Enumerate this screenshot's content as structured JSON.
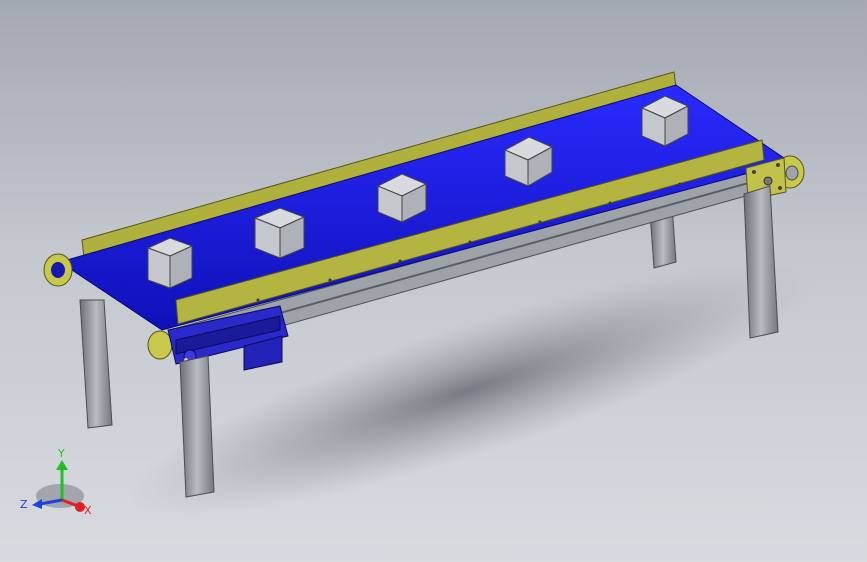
{
  "viewport": {
    "background_top": "#a3a8b2",
    "background_bottom": "#d8dbe0"
  },
  "model": {
    "belt_color": "#1f1fd8",
    "guide_color": "#a8a83a",
    "frame_color": "#8a8f96",
    "box_count": 5
  },
  "triad": {
    "x_label": "X",
    "y_label": "Y",
    "z_label": "Z",
    "x_color": "#e02020",
    "y_color": "#20c020",
    "z_color": "#2040e0"
  }
}
